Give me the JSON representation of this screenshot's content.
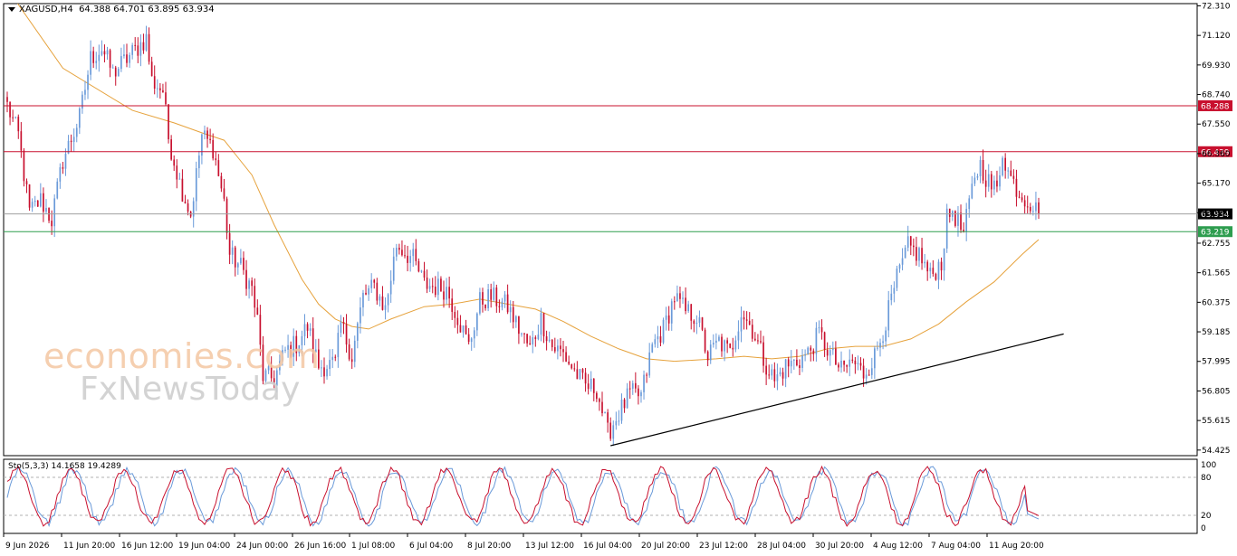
{
  "header": {
    "symbol": "XAGUSD,H4",
    "ohlc": "64.388 64.701 63.895 63.934"
  },
  "stoch_label": "Sto(5,3,3) 14.1658 19.4289",
  "watermark": {
    "line1": "economies.com",
    "line2": "FxNewsToday"
  },
  "colors": {
    "bull": "#6a9ad9",
    "bear": "#c8102e",
    "ma": "#e6a23c",
    "resistance": "#c8102e",
    "support": "#2e9d4f",
    "current": "#a0a0a0",
    "trendline": "#000000",
    "stoch_main": "#6a9ad9",
    "stoch_signal": "#c8102e"
  },
  "chart_data": [
    {
      "type": "candlestick",
      "symbol": "XAGUSD",
      "timeframe": "H4",
      "y_ticks": [
        72.31,
        71.12,
        69.93,
        68.74,
        67.55,
        66.36,
        65.17,
        63.98,
        62.755,
        61.565,
        60.375,
        59.185,
        57.995,
        56.805,
        55.615,
        54.425
      ],
      "y_tick_labels": [
        "72.310",
        "71.120",
        "69.930",
        "68.740",
        "67.550",
        "66.360",
        "65.170",
        "63.980",
        "62.755",
        "61.565",
        "60.375",
        "59.185",
        "57.995",
        "56.805",
        "55.615",
        "54.425"
      ],
      "ylim": [
        54.2,
        72.4
      ],
      "x_labels": [
        "9 Jun 2026",
        "11 Jun 20:00",
        "16 Jun 12:00",
        "19 Jun 04:00",
        "24 Jun 00:00",
        "26 Jun 16:00",
        "1 Jul 08:00",
        "6 Jul 04:00",
        "8 Jul 20:00",
        "13 Jul 12:00",
        "16 Jul 04:00",
        "20 Jul 20:00",
        "23 Jul 12:00",
        "28 Jul 04:00",
        "30 Jul 20:00",
        "4 Aug 12:00",
        "7 Aug 04:00",
        "11 Aug 20:00"
      ],
      "levels": [
        {
          "value": 68.288,
          "label": "68.288",
          "kind": "resistance"
        },
        {
          "value": 66.439,
          "label": "66.439",
          "kind": "resistance"
        },
        {
          "value": 63.934,
          "label": "63.934",
          "kind": "current"
        },
        {
          "value": 63.219,
          "label": "63.219",
          "kind": "support"
        }
      ],
      "trendline": {
        "from": {
          "candle": 217,
          "price": 54.6
        },
        "to": {
          "candle": 380,
          "price": 59.1
        }
      },
      "path_points": [
        [
          0,
          68.3
        ],
        [
          4,
          67.1
        ],
        [
          8,
          64.0
        ],
        [
          12,
          64.5
        ],
        [
          16,
          63.7
        ],
        [
          20,
          66.1
        ],
        [
          26,
          67.8
        ],
        [
          30,
          70.2
        ],
        [
          34,
          70.6
        ],
        [
          38,
          69.6
        ],
        [
          44,
          70.3
        ],
        [
          50,
          71.0
        ],
        [
          52,
          69.3
        ],
        [
          56,
          68.9
        ],
        [
          58,
          67.0
        ],
        [
          62,
          65.2
        ],
        [
          66,
          63.9
        ],
        [
          70,
          67.1
        ],
        [
          74,
          66.6
        ],
        [
          78,
          64.4
        ],
        [
          80,
          62.3
        ],
        [
          84,
          61.8
        ],
        [
          88,
          60.9
        ],
        [
          90,
          59.6
        ],
        [
          92,
          57.4
        ],
        [
          96,
          57.3
        ],
        [
          100,
          58.4
        ],
        [
          104,
          58.7
        ],
        [
          108,
          59.4
        ],
        [
          112,
          57.8
        ],
        [
          118,
          57.9
        ],
        [
          120,
          59.5
        ],
        [
          124,
          58.2
        ],
        [
          128,
          60.6
        ],
        [
          132,
          61.0
        ],
        [
          136,
          60.1
        ],
        [
          140,
          62.7
        ],
        [
          146,
          62.1
        ],
        [
          150,
          61.1
        ],
        [
          158,
          60.9
        ],
        [
          162,
          59.8
        ],
        [
          166,
          58.6
        ],
        [
          170,
          60.4
        ],
        [
          174,
          60.6
        ],
        [
          180,
          60.2
        ],
        [
          184,
          59.3
        ],
        [
          188,
          58.5
        ],
        [
          192,
          59.7
        ],
        [
          196,
          58.6
        ],
        [
          200,
          58.3
        ],
        [
          204,
          57.6
        ],
        [
          208,
          57.0
        ],
        [
          212,
          56.9
        ],
        [
          216,
          55.1
        ],
        [
          220,
          55.9
        ],
        [
          224,
          56.7
        ],
        [
          228,
          56.6
        ],
        [
          232,
          58.6
        ],
        [
          236,
          59.3
        ],
        [
          240,
          60.6
        ],
        [
          244,
          60.0
        ],
        [
          248,
          59.8
        ],
        [
          252,
          58.2
        ],
        [
          256,
          58.8
        ],
        [
          260,
          58.3
        ],
        [
          264,
          60.0
        ],
        [
          268,
          59.3
        ],
        [
          272,
          58.1
        ],
        [
          276,
          57.2
        ],
        [
          280,
          57.8
        ],
        [
          284,
          58.0
        ],
        [
          288,
          58.3
        ],
        [
          292,
          59.1
        ],
        [
          296,
          58.3
        ],
        [
          300,
          57.6
        ],
        [
          304,
          58.0
        ],
        [
          308,
          57.5
        ],
        [
          312,
          58.2
        ],
        [
          316,
          59.6
        ],
        [
          320,
          61.3
        ],
        [
          324,
          62.6
        ],
        [
          328,
          62.3
        ],
        [
          332,
          61.4
        ],
        [
          336,
          62.0
        ],
        [
          338,
          63.7
        ],
        [
          340,
          64.1
        ],
        [
          344,
          63.1
        ],
        [
          348,
          65.5
        ],
        [
          350,
          65.9
        ],
        [
          354,
          65.0
        ],
        [
          356,
          64.9
        ],
        [
          358,
          66.5
        ],
        [
          360,
          65.6
        ],
        [
          364,
          64.8
        ],
        [
          368,
          64.4
        ],
        [
          371,
          63.93
        ]
      ],
      "moving_average": [
        [
          0,
          73.0
        ],
        [
          20,
          69.8
        ],
        [
          45,
          68.1
        ],
        [
          60,
          67.6
        ],
        [
          70,
          67.2
        ],
        [
          78,
          66.9
        ],
        [
          88,
          65.5
        ],
        [
          96,
          63.5
        ],
        [
          106,
          61.3
        ],
        [
          112,
          60.3
        ],
        [
          118,
          59.7
        ],
        [
          124,
          59.4
        ],
        [
          130,
          59.3
        ],
        [
          138,
          59.7
        ],
        [
          150,
          60.2
        ],
        [
          160,
          60.3
        ],
        [
          170,
          60.5
        ],
        [
          180,
          60.3
        ],
        [
          190,
          60.1
        ],
        [
          200,
          59.6
        ],
        [
          210,
          59.0
        ],
        [
          220,
          58.5
        ],
        [
          230,
          58.1
        ],
        [
          240,
          58.0
        ],
        [
          255,
          58.1
        ],
        [
          265,
          58.2
        ],
        [
          275,
          58.1
        ],
        [
          285,
          58.2
        ],
        [
          295,
          58.5
        ],
        [
          305,
          58.6
        ],
        [
          315,
          58.6
        ],
        [
          325,
          58.9
        ],
        [
          335,
          59.5
        ],
        [
          345,
          60.4
        ],
        [
          355,
          61.2
        ],
        [
          365,
          62.3
        ],
        [
          371,
          62.9
        ]
      ],
      "candle_count": 372
    },
    {
      "type": "line",
      "name": "Sto(5,3,3)",
      "ylim": [
        0,
        100
      ],
      "y_ticks": [
        100,
        80,
        20,
        0
      ],
      "levels": [
        80,
        20
      ],
      "series": [
        {
          "name": "main",
          "period": 10.6,
          "phase": 0.0,
          "last": 14.1658
        },
        {
          "name": "signal",
          "period": 10.6,
          "phase": 1.3,
          "last": 19.4289
        }
      ]
    }
  ]
}
